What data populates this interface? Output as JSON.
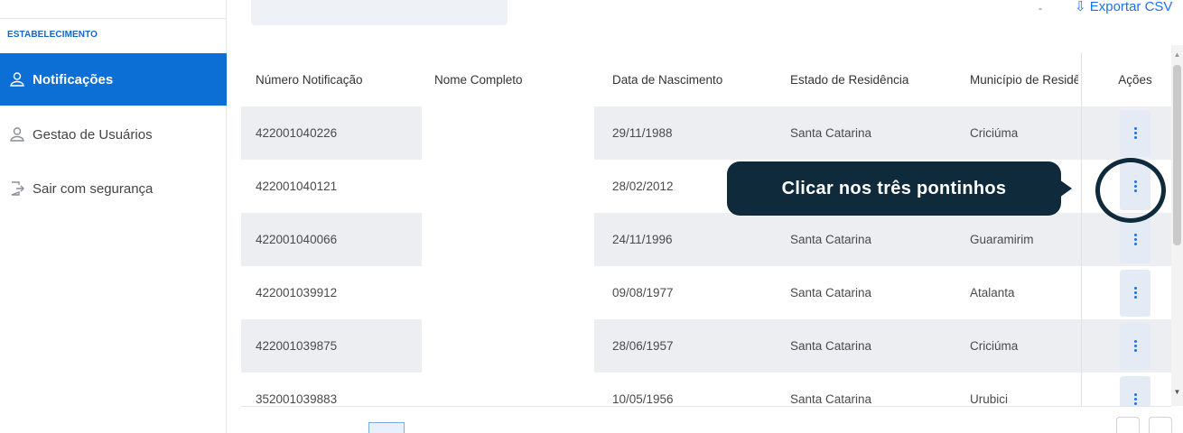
{
  "sidebar": {
    "section_label": "ESTABELECIMENTO",
    "items": [
      {
        "label": "Notificações",
        "icon": "user-icon",
        "active": true
      },
      {
        "label": "Gestao de Usuários",
        "icon": "user-icon",
        "active": false
      },
      {
        "label": "Sair com segurança",
        "icon": "logout-icon",
        "active": false
      }
    ]
  },
  "toolbar": {
    "search_placeholder": "",
    "dash": "-",
    "export_label": "⇩ Exportar CSV"
  },
  "table": {
    "headers": [
      "Número Notificação",
      "Nome Completo",
      "Data de Nascimento",
      "Estado de Residência",
      "Município de Residên",
      "Ações"
    ],
    "rows": [
      {
        "numero": "422001040226",
        "nome": "",
        "nascimento": "29/11/1988",
        "estado": "Santa Catarina",
        "municipio": "Criciúma"
      },
      {
        "numero": "422001040121",
        "nome": "",
        "nascimento": "28/02/2012",
        "estado": "",
        "municipio": ""
      },
      {
        "numero": "422001040066",
        "nome": "",
        "nascimento": "24/11/1996",
        "estado": "Santa Catarina",
        "municipio": "Guaramirim"
      },
      {
        "numero": "422001039912",
        "nome": "",
        "nascimento": "09/08/1977",
        "estado": "Santa Catarina",
        "municipio": "Atalanta"
      },
      {
        "numero": "422001039875",
        "nome": "",
        "nascimento": "28/06/1957",
        "estado": "Santa Catarina",
        "municipio": "Criciúma"
      },
      {
        "numero": "352001039883",
        "nome": "",
        "nascimento": "10/05/1956",
        "estado": "Santa Catarina",
        "municipio": "Urubici"
      }
    ]
  },
  "callout": {
    "text": "Clicar nos três pontinhos"
  },
  "colors": {
    "accent": "#0b6fd6",
    "callout_bg": "#0e2a3b",
    "row_gray": "#eceef1"
  }
}
